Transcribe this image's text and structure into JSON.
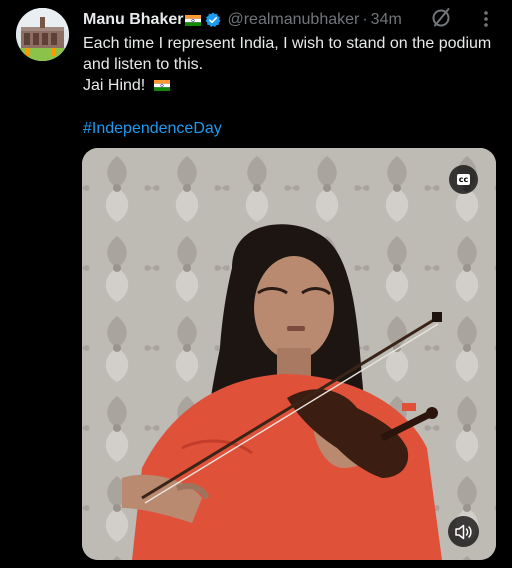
{
  "author": {
    "name": "Manu Bhaker",
    "handle": "@realmanubhaker",
    "separator": "·",
    "time": "34m",
    "verified_color": "#1d9bf0"
  },
  "tweet": {
    "line1": "Each time I represent India, I wish to stand on the podium",
    "line2": "and listen to this.",
    "line3": "Jai Hind!",
    "hashtag": "#IndependenceDay"
  },
  "media": {
    "cc_label": "cc",
    "icons": [
      "grok-icon",
      "more-icon",
      "closed-captions-icon",
      "volume-icon"
    ]
  },
  "colors": {
    "background": "#000000",
    "text": "#e7e9ea",
    "secondary": "#71767b",
    "link": "#1d9bf0"
  }
}
